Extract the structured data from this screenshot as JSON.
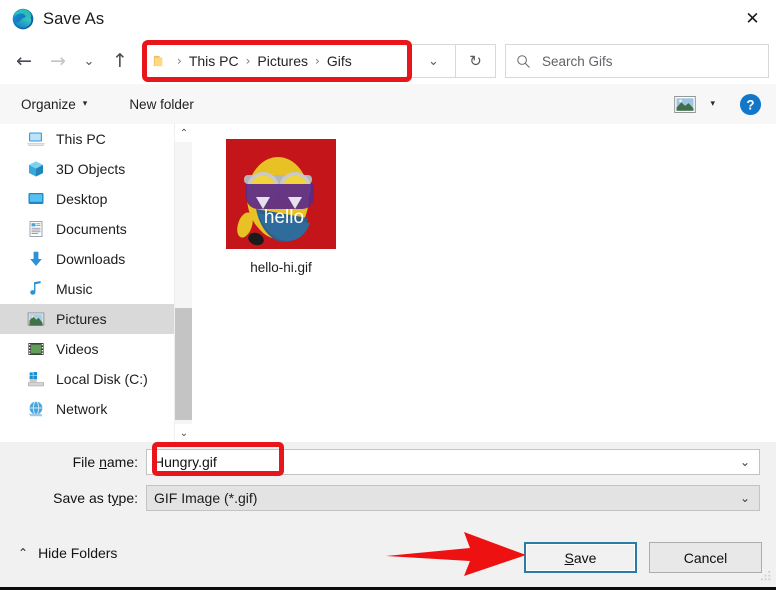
{
  "window": {
    "title": "Save As",
    "logo_icon": "edge-logo-icon",
    "close_icon": "close-icon",
    "close_glyph": "✕"
  },
  "navbar": {
    "back_icon": "back-arrow-icon",
    "back_glyph": "←",
    "forward_icon": "forward-arrow-icon",
    "forward_glyph": "→",
    "recent_icon": "chevron-down-icon",
    "recent_glyph": "⌄",
    "up_icon": "up-arrow-icon",
    "up_glyph": "↑",
    "breadcrumb": {
      "folder_icon": "folder-icon",
      "separator": "›",
      "items": [
        "This PC",
        "Pictures",
        "Gifs"
      ],
      "highlight_color": "#e8161b"
    },
    "address_dropdown_icon": "chevron-down-icon",
    "address_dropdown_glyph": "⌄",
    "refresh_icon": "refresh-icon",
    "refresh_glyph": "↻",
    "search": {
      "icon": "search-icon",
      "placeholder": "Search Gifs",
      "value": ""
    }
  },
  "command_bar": {
    "organize_label": "Organize",
    "organize_caret": "▾",
    "new_folder_label": "New folder",
    "view_icon": "view-layout-icon",
    "view_caret": "▾",
    "help_icon": "help-icon",
    "help_glyph": "?"
  },
  "nav_pane": {
    "items": [
      {
        "label": "This PC",
        "icon": "this-pc-icon",
        "selected": false
      },
      {
        "label": "3D Objects",
        "icon": "3d-objects-icon",
        "selected": false
      },
      {
        "label": "Desktop",
        "icon": "desktop-icon",
        "selected": false
      },
      {
        "label": "Documents",
        "icon": "documents-icon",
        "selected": false
      },
      {
        "label": "Downloads",
        "icon": "downloads-icon",
        "selected": false
      },
      {
        "label": "Music",
        "icon": "music-icon",
        "selected": false
      },
      {
        "label": "Pictures",
        "icon": "pictures-icon",
        "selected": true
      },
      {
        "label": "Videos",
        "icon": "videos-icon",
        "selected": false
      },
      {
        "label": "Local Disk (C:)",
        "icon": "local-disk-icon",
        "selected": false
      },
      {
        "label": "Network",
        "icon": "network-icon",
        "selected": false
      }
    ],
    "scrollbar": {
      "up_glyph": "⌃",
      "down_glyph": "⌄"
    }
  },
  "file_pane": {
    "files": [
      {
        "name": "hello-hi.gif",
        "thumbnail_text": "hello",
        "thumbnail_bg": "#c4151b"
      }
    ]
  },
  "form": {
    "file_name_label_pre": "File ",
    "file_name_label_accel": "n",
    "file_name_label_post": "ame:",
    "file_name_value": "Hungry.gif",
    "file_name_dropdown_glyph": "⌄",
    "save_type_label_pre": "Save as t",
    "save_type_label_accel": "y",
    "save_type_label_post": "pe:",
    "save_type_value": "GIF Image (*.gif)",
    "save_type_dropdown_glyph": "⌄",
    "highlight_color": "#e8161b"
  },
  "footer": {
    "hide_folders_label": "Hide Folders",
    "hide_folders_chevron": "⌃",
    "save_label_pre": "",
    "save_label_accel": "S",
    "save_label_post": "ave",
    "cancel_label": "Cancel",
    "focus_border_color": "#2a7ca5",
    "annotation_arrow_color": "#ee1111"
  }
}
